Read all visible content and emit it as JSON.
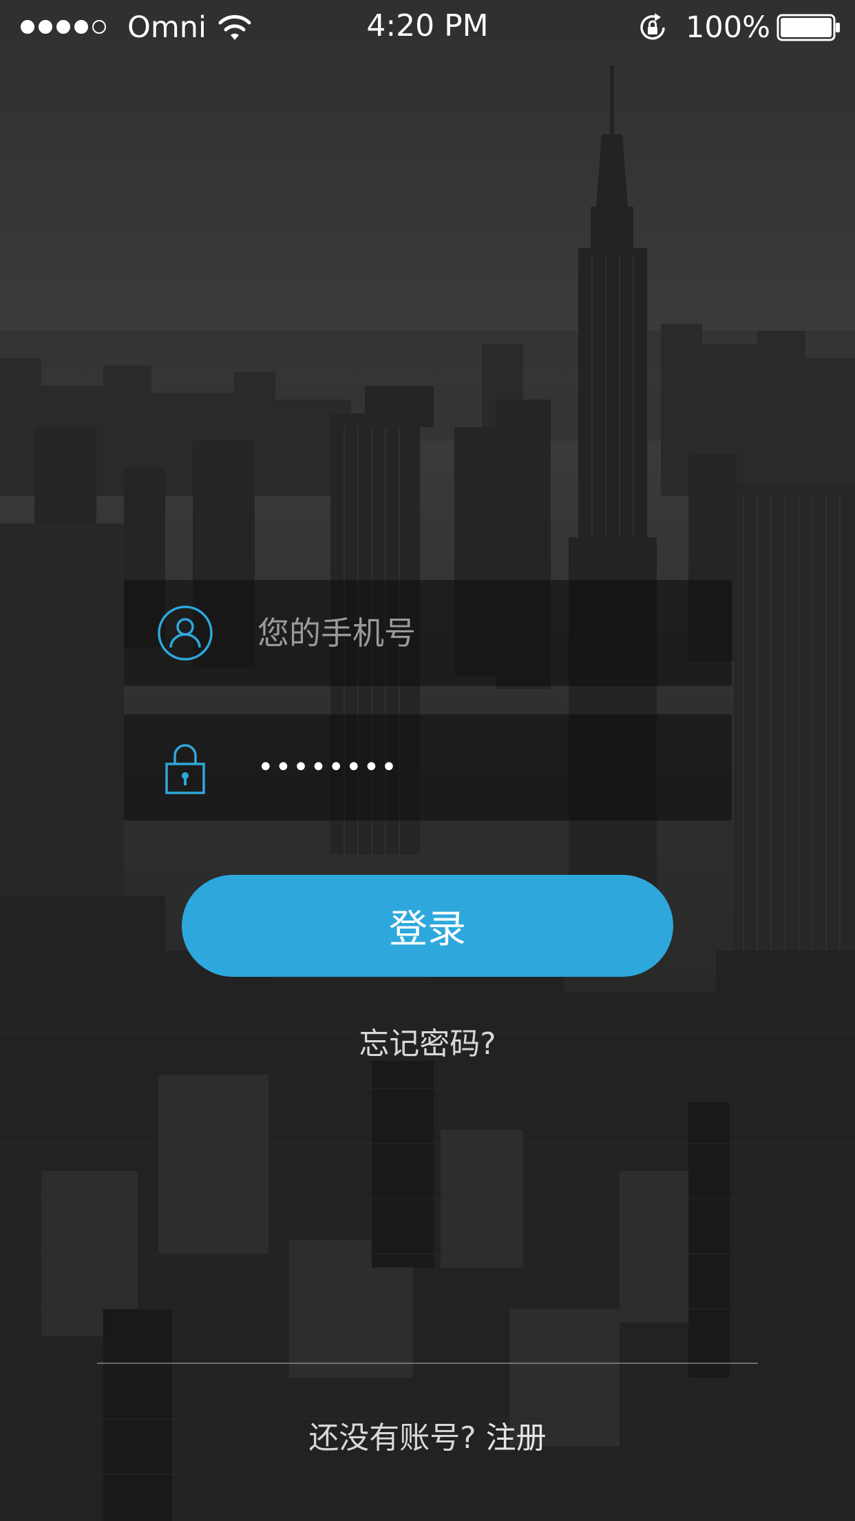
{
  "status_bar": {
    "signal_strength": 4,
    "signal_max": 5,
    "carrier": "Omni",
    "time": "4:20 PM",
    "battery_percent_text": "100%",
    "battery_level": 1.0,
    "icons": [
      "wifi-icon",
      "rotation-lock-icon",
      "battery-icon"
    ]
  },
  "login_form": {
    "phone_field": {
      "icon": "user-icon",
      "placeholder": "您的手机号",
      "value": ""
    },
    "password_field": {
      "icon": "lock-icon",
      "value": "••••••••"
    },
    "login_button_label": "登录",
    "forgot_password_label": "忘记密码?"
  },
  "footer": {
    "no_account_text": "还没有账号?",
    "register_label": "注册"
  },
  "colors": {
    "accent": "#2ea8dc",
    "field_background": "rgba(12,12,12,0.55)",
    "background_tint": "#2a2a2a"
  }
}
